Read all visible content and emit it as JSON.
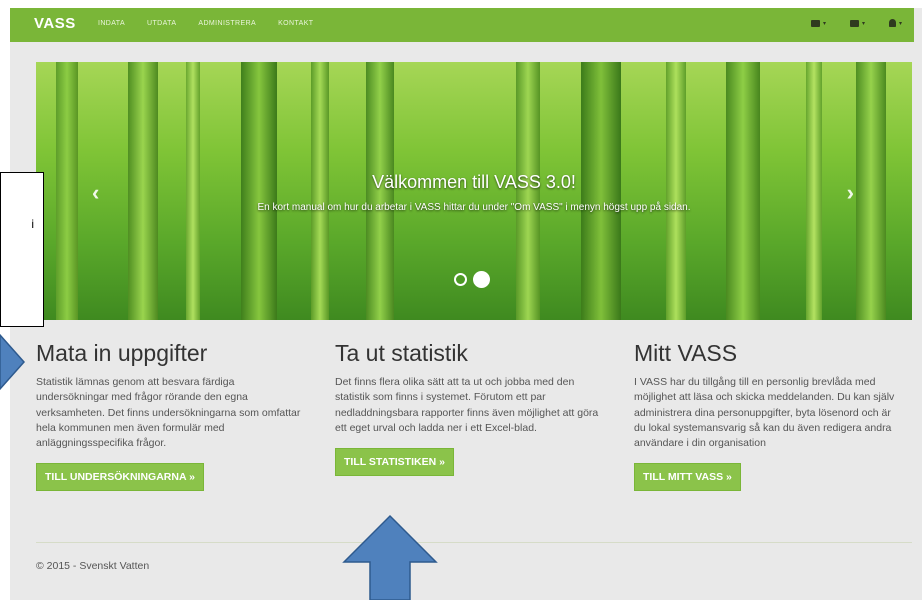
{
  "navbar": {
    "brand": "VASS",
    "links": [
      "INDATA",
      "UTDATA",
      "ADMINISTRERA",
      "KONTAKT"
    ],
    "right_icons": [
      "mail-icon",
      "list-icon",
      "user-icon"
    ],
    "dropdown_caret": "▾"
  },
  "carousel": {
    "title": "Välkommen till VASS 3.0!",
    "text": "En kort manual om hur du arbetar i VASS hittar du under \"Om VASS\" i menyn högst upp på sidan.",
    "prev_glyph": "‹",
    "next_glyph": "›"
  },
  "overlay_box": {
    "text": "i"
  },
  "columns": [
    {
      "heading": "Mata in uppgifter",
      "text": "Statistik lämnas genom att besvara färdiga undersökningar med frågor rörande den egna verksamheten. Det finns undersökningarna som omfattar hela kommunen men även formulär med anläggningsspecifika frågor.",
      "button": "TILL UNDERSÖKNINGARNA »"
    },
    {
      "heading": "Ta ut statistik",
      "text": "Det finns flera olika sätt att ta ut och jobba med den statistik som finns i systemet. Förutom ett par nedladdningsbara rapporter finns även möjlighet att göra ett eget urval och ladda ner i ett Excel-blad.",
      "button": "TILL STATISTIKEN »"
    },
    {
      "heading": "Mitt VASS",
      "text": "I VASS har du tillgång till en personlig brevlåda med möjlighet att läsa och skicka meddelanden. Du kan själv administrera dina personuppgifter, byta lösenord och är du lokal systemansvarig så kan du även redigera andra användare i din organisation",
      "button": "TILL MITT VASS »"
    }
  ],
  "footer": {
    "text": "© 2015 - Svenskt Vatten"
  },
  "colors": {
    "nav_green": "#7ab638",
    "button_green": "#8bc34a",
    "arrow_blue": "#4f81bd"
  }
}
